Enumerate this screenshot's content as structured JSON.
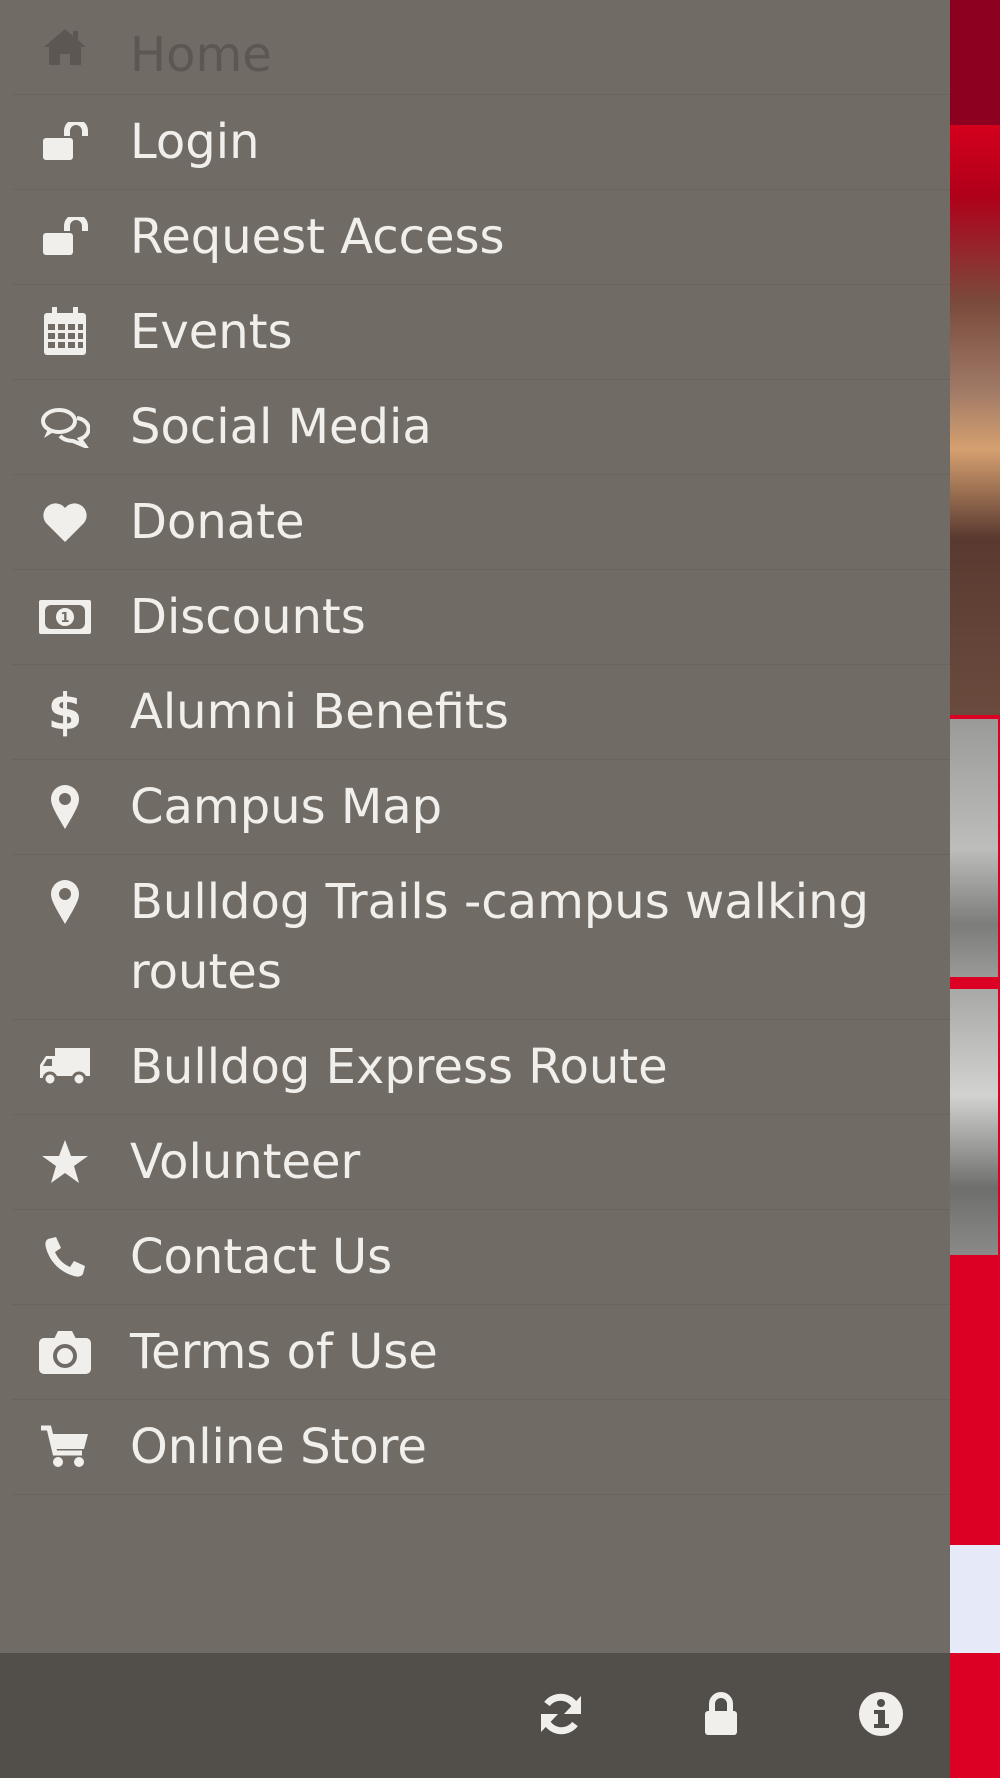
{
  "menu": {
    "items": [
      {
        "label": "Home",
        "icon": "home-icon"
      },
      {
        "label": "Login",
        "icon": "unlock-icon"
      },
      {
        "label": "Request Access",
        "icon": "unlock-icon"
      },
      {
        "label": "Events",
        "icon": "calendar-icon"
      },
      {
        "label": "Social Media",
        "icon": "comments-icon"
      },
      {
        "label": "Donate",
        "icon": "heart-icon"
      },
      {
        "label": "Discounts",
        "icon": "money-icon"
      },
      {
        "label": "Alumni Benefits",
        "icon": "dollar-icon"
      },
      {
        "label": "Campus Map",
        "icon": "map-marker-icon"
      },
      {
        "label": "Bulldog Trails -campus walking routes",
        "icon": "map-marker-icon"
      },
      {
        "label": "Bulldog Express Route",
        "icon": "truck-icon"
      },
      {
        "label": "Volunteer",
        "icon": "star-icon"
      },
      {
        "label": "Contact Us",
        "icon": "phone-icon"
      },
      {
        "label": "Terms of Use",
        "icon": "camera-icon"
      },
      {
        "label": "Online Store",
        "icon": "shopping-cart-icon"
      }
    ]
  },
  "footer": {
    "buttons": [
      {
        "icon": "refresh-icon"
      },
      {
        "icon": "lock-icon"
      },
      {
        "icon": "info-icon"
      }
    ]
  },
  "colors": {
    "drawer_bg": "#716b65",
    "footer_bg": "#524e4a",
    "menu_text": "#f1efec",
    "active_text": "#5c5752",
    "brand_red": "#dc0024"
  }
}
